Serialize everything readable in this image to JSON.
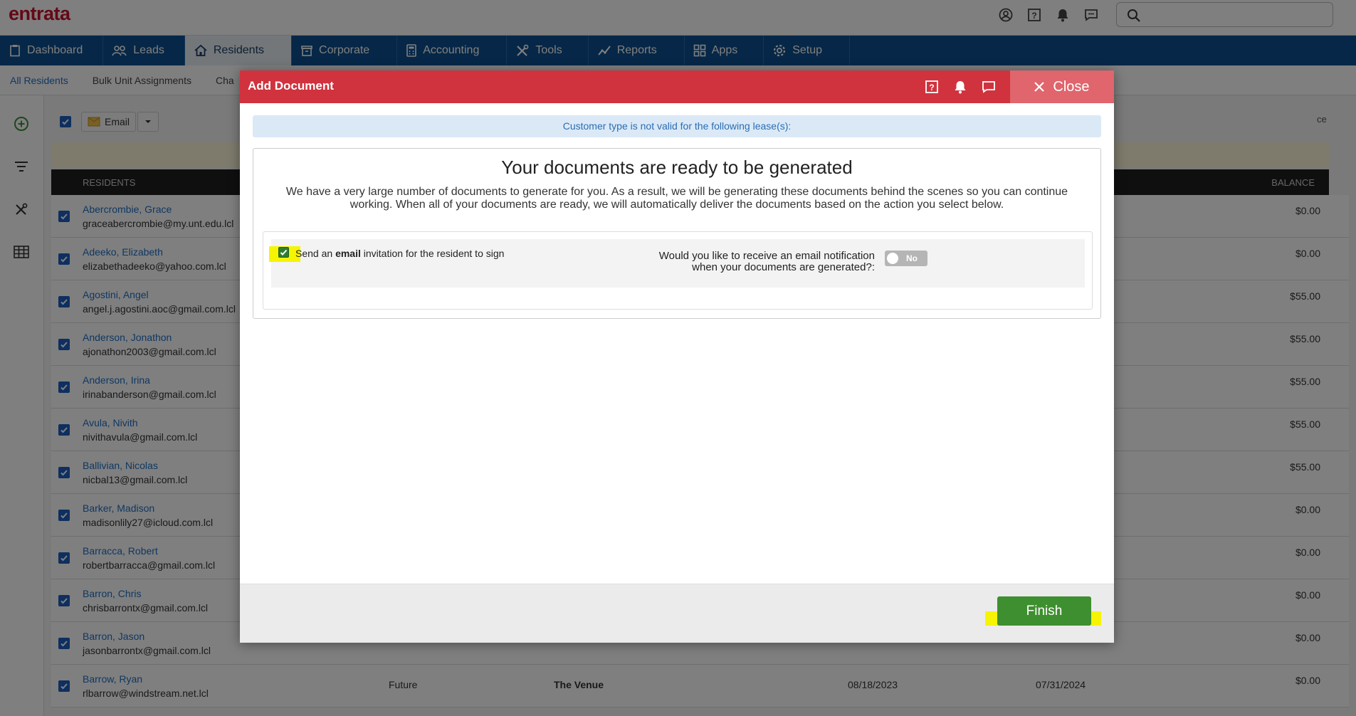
{
  "app": {
    "logo": "entrata"
  },
  "search": {
    "placeholder": ""
  },
  "nav": {
    "items": [
      {
        "label": "Dashboard",
        "icon": "clipboard-icon"
      },
      {
        "label": "Leads",
        "icon": "users-icon"
      },
      {
        "label": "Residents",
        "icon": "home-icon",
        "active": true
      },
      {
        "label": "Corporate",
        "icon": "building-icon"
      },
      {
        "label": "Accounting",
        "icon": "calculator-icon"
      },
      {
        "label": "Tools",
        "icon": "tools-icon"
      },
      {
        "label": "Reports",
        "icon": "chart-icon"
      },
      {
        "label": "Apps",
        "icon": "apps-icon"
      },
      {
        "label": "Setup",
        "icon": "gear-icon"
      }
    ]
  },
  "subnav": {
    "items": [
      {
        "label": "All Residents",
        "active": true
      },
      {
        "label": "Bulk Unit Assignments"
      },
      {
        "label": "Cha"
      }
    ]
  },
  "toolbar": {
    "email_label": "Email",
    "right_stub": "ce"
  },
  "table": {
    "header_residents": "RESIDENTS",
    "header_balance": "BALANCE",
    "rows": [
      {
        "name": "Abercrombie, Grace",
        "email": "graceabercrombie@my.unt.edu.lcl",
        "status": "",
        "property": "",
        "start": "",
        "end": "",
        "balance": "$0.00"
      },
      {
        "name": "Adeeko, Elizabeth",
        "email": "elizabethadeeko@yahoo.com.lcl",
        "status": "",
        "property": "",
        "start": "",
        "end": "",
        "balance": "$0.00"
      },
      {
        "name": "Agostini, Angel",
        "email": "angel.j.agostini.aoc@gmail.com.lcl",
        "status": "",
        "property": "",
        "start": "",
        "end": "",
        "balance": "$55.00"
      },
      {
        "name": "Anderson, Jonathon",
        "email": "ajonathon2003@gmail.com.lcl",
        "status": "",
        "property": "",
        "start": "",
        "end": "",
        "balance": "$55.00"
      },
      {
        "name": "Anderson, Irina",
        "email": "irinabanderson@gmail.com.lcl",
        "status": "",
        "property": "",
        "start": "",
        "end": "",
        "balance": "$55.00"
      },
      {
        "name": "Avula, Nivith",
        "email": "nivithavula@gmail.com.lcl",
        "status": "",
        "property": "",
        "start": "",
        "end": "",
        "balance": "$55.00"
      },
      {
        "name": "Ballivian, Nicolas",
        "email": "nicbal13@gmail.com.lcl",
        "status": "",
        "property": "",
        "start": "",
        "end": "",
        "balance": "$55.00"
      },
      {
        "name": "Barker, Madison",
        "email": "madisonlily27@icloud.com.lcl",
        "status": "",
        "property": "",
        "start": "",
        "end": "",
        "balance": "$0.00"
      },
      {
        "name": "Barracca, Robert",
        "email": "robertbarracca@gmail.com.lcl",
        "status": "",
        "property": "",
        "start": "",
        "end": "",
        "balance": "$0.00"
      },
      {
        "name": "Barron, Chris",
        "email": "chrisbarrontx@gmail.com.lcl",
        "status": "",
        "property": "",
        "start": "",
        "end": "",
        "balance": "$0.00"
      },
      {
        "name": "Barron, Jason",
        "email": "jasonbarrontx@gmail.com.lcl",
        "status": "",
        "property": "",
        "start": "",
        "end": "",
        "balance": "$0.00"
      },
      {
        "name": "Barrow, Ryan",
        "email": "rlbarrow@windstream.net.lcl",
        "status": "Future",
        "property": "The Venue",
        "start": "08/18/2023",
        "end": "07/31/2024",
        "balance": "$0.00"
      }
    ]
  },
  "modal": {
    "title": "Add Document",
    "close_label": "Close",
    "info_strip": "Customer type is not valid for the following lease(s):",
    "heading": "Your documents are ready to be generated",
    "description": "We have a very large number of documents to generate for you. As a result, we will be generating these documents behind the scenes so you can continue working. When all of your documents are ready, we will automatically deliver the documents based on the action you select below.",
    "sign_option": {
      "prefix": "Send an ",
      "bold": "email",
      "suffix": " invitation for the resident to sign",
      "checked": true
    },
    "notification_question": "Would you like to receive an email notification when your documents are generated?:",
    "notification_toggle": "No",
    "finish_label": "Finish"
  }
}
